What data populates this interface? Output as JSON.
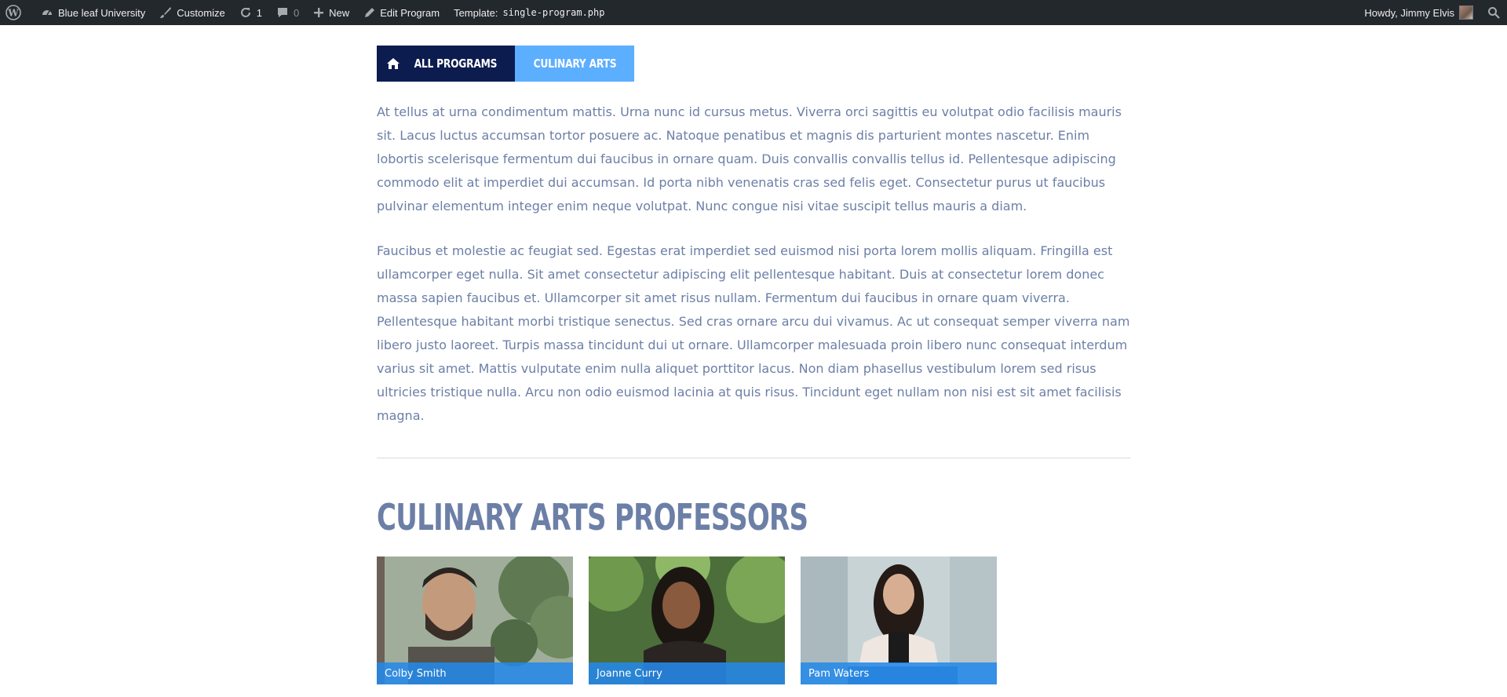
{
  "adminbar": {
    "site_name": "Blue leaf University",
    "customize": "Customize",
    "updates_count": "1",
    "comments_count": "0",
    "new_label": "New",
    "edit_label": "Edit Program",
    "template_label": "Template:",
    "template_file": "single-program.php",
    "greeting": "Howdy, Jimmy Elvis",
    "icons": [
      "wordpress-icon",
      "dashboard-icon",
      "brush-icon",
      "updates-icon",
      "comment-icon",
      "plus-icon",
      "pencil-icon",
      "search-icon"
    ]
  },
  "breadcrumb": {
    "all_programs": "ALL PROGRAMS",
    "current": "CULINARY ARTS"
  },
  "body": {
    "paragraph1": "At tellus at urna condimentum mattis. Urna nunc id cursus metus. Viverra orci sagittis eu volutpat odio facilisis mauris sit. Lacus luctus accumsan tortor posuere ac. Natoque penatibus et magnis dis parturient montes nascetur. Enim lobortis scelerisque fermentum dui faucibus in ornare quam. Duis convallis convallis tellus id. Pellentesque adipiscing commodo elit at imperdiet dui accumsan. Id porta nibh venenatis cras sed felis eget. Consectetur purus ut faucibus pulvinar elementum integer enim neque volutpat. Nunc congue nisi vitae suscipit tellus mauris a diam.",
    "paragraph2": "Faucibus et molestie ac feugiat sed. Egestas erat imperdiet sed euismod nisi porta lorem mollis aliquam. Fringilla est ullamcorper eget nulla. Sit amet consectetur adipiscing elit pellentesque habitant. Duis at consectetur lorem donec massa sapien faucibus et. Ullamcorper sit amet risus nullam. Fermentum dui faucibus in ornare quam viverra. Pellentesque habitant morbi tristique senectus. Sed cras ornare arcu dui vivamus. Ac ut consequat semper viverra nam libero justo laoreet. Turpis massa tincidunt dui ut ornare. Ullamcorper malesuada proin libero nunc consequat interdum varius sit amet. Mattis vulputate enim nulla aliquet porttitor lacus. Non diam phasellus vestibulum lorem sed risus ultricies tristique nulla. Arcu non odio euismod lacinia at quis risus. Tincidunt eget nullam non nisi est sit amet facilisis magna."
  },
  "professors": {
    "heading": "CULINARY ARTS PROFESSORS",
    "items": [
      {
        "name": "Colby Smith"
      },
      {
        "name": "Joanne Curry"
      },
      {
        "name": "Pam Waters"
      }
    ]
  },
  "colors": {
    "adminbar_bg": "#23282d",
    "btn_dark": "#0d1c4f",
    "btn_light": "#5caeff",
    "text": "#6c7fa6",
    "caption_bg": "#2489e8"
  }
}
